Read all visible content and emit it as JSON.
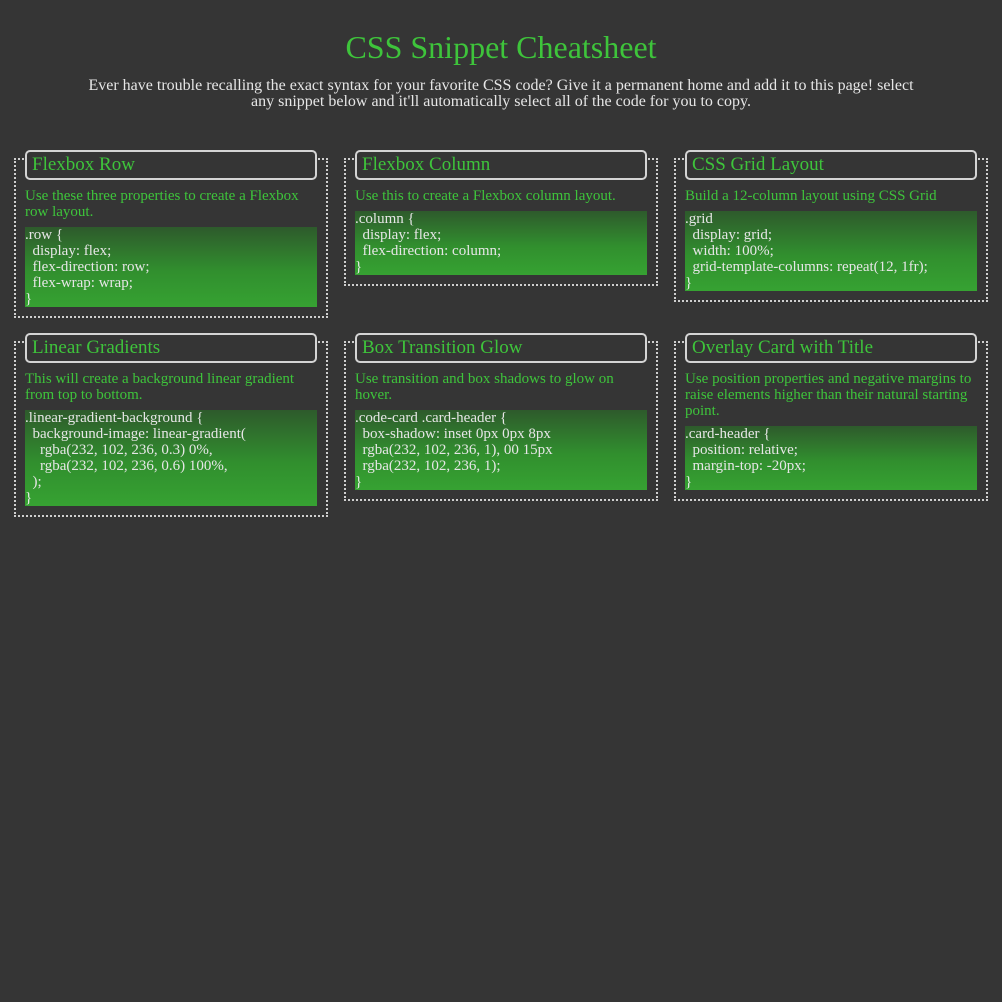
{
  "header": {
    "title": "CSS Snippet Cheatsheet",
    "intro": "Ever have trouble recalling the exact syntax for your favorite CSS code? Give it a permanent home and add it to this page! select any snippet below and it'll automatically select all of the code for you to copy."
  },
  "colors": {
    "background": "#353535",
    "accent_green": "#3ec43b",
    "text": "#e6e6e6",
    "border": "#cfcfcf",
    "code_gradient_top": "#2e5a2c",
    "code_gradient_bottom": "#36a232"
  },
  "cards": [
    {
      "title": "Flexbox Row",
      "description": "Use these three properties to create a Flexbox row layout.",
      "code": ".row {\n  display: flex;\n  flex-direction: row;\n  flex-wrap: wrap;\n}"
    },
    {
      "title": "Flexbox Column",
      "description": "Use this to create a Flexbox column layout.",
      "code": ".column {\n  display: flex;\n  flex-direction: column;\n}"
    },
    {
      "title": "CSS Grid Layout",
      "description": "Build a 12-column layout using CSS Grid",
      "code": ".grid\n  display: grid;\n  width: 100%;\n  grid-template-columns: repeat(12, 1fr);\n}"
    },
    {
      "title": "Linear Gradients",
      "description": "This will create a background linear gradient from top to bottom.",
      "code": ".linear-gradient-background {\n  background-image: linear-gradient(\n    rgba(232, 102, 236, 0.3) 0%,\n    rgba(232, 102, 236, 0.6) 100%,\n  );\n}"
    },
    {
      "title": "Box Transition Glow",
      "description": "Use transition and box shadows to glow on hover.",
      "code": ".code-card .card-header {\n  box-shadow: inset 0px 0px 8px\n  rgba(232, 102, 236, 1), 00 15px\n  rgba(232, 102, 236, 1);\n}"
    },
    {
      "title": "Overlay Card with Title",
      "description": "Use position properties and negative margins to raise elements higher than their natural starting point.",
      "code": ".card-header {\n  position: relative;\n  margin-top: -20px;\n}"
    }
  ]
}
